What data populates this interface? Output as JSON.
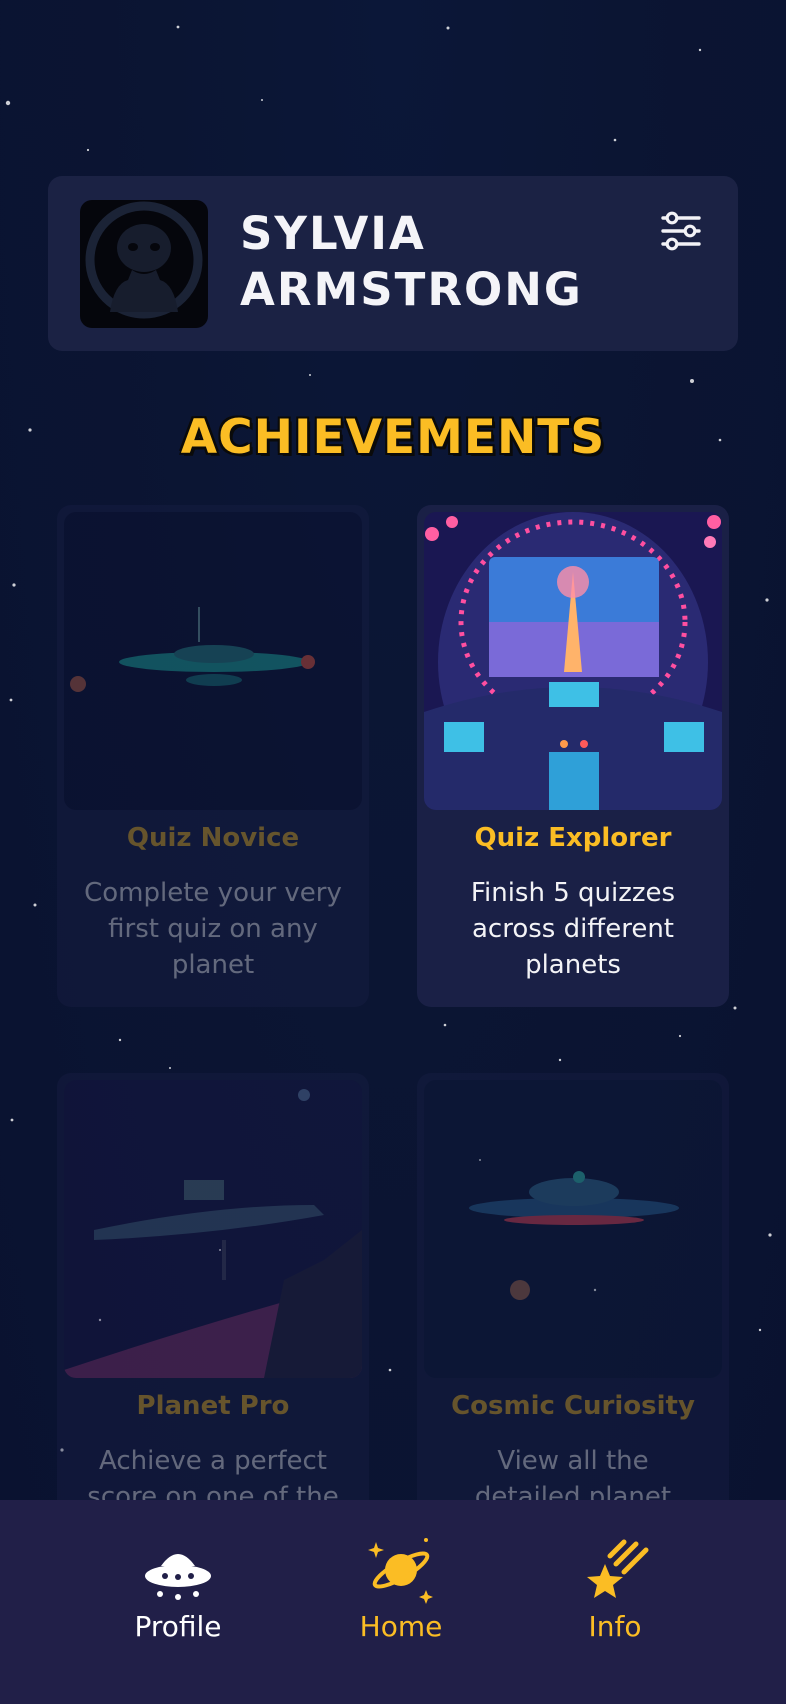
{
  "profile": {
    "name": "SYLVIA ARMSTRONG"
  },
  "achievements": {
    "title": "ACHIEVEMENTS",
    "items": [
      {
        "title": "Quiz Novice",
        "description": "Complete your very first quiz on any planet",
        "locked": true
      },
      {
        "title": "Quiz Explorer",
        "description": "Finish 5 quizzes across different planets",
        "locked": false
      },
      {
        "title": "Planet Pro",
        "description": "Achieve a perfect score on one of the",
        "locked": true
      },
      {
        "title": "Cosmic Curiosity",
        "description": "View all the detailed planet pages in the",
        "locked": true
      }
    ]
  },
  "nav": {
    "items": [
      {
        "label": "Profile",
        "icon": "ufo-icon",
        "active": true
      },
      {
        "label": "Home",
        "icon": "planet-icon",
        "active": false
      },
      {
        "label": "Info",
        "icon": "shooting-star-icon",
        "active": false
      }
    ]
  },
  "colors": {
    "accent": "#fbbd24",
    "background": "#0a1433",
    "card": "#1a2046",
    "nav": "#211f48"
  }
}
